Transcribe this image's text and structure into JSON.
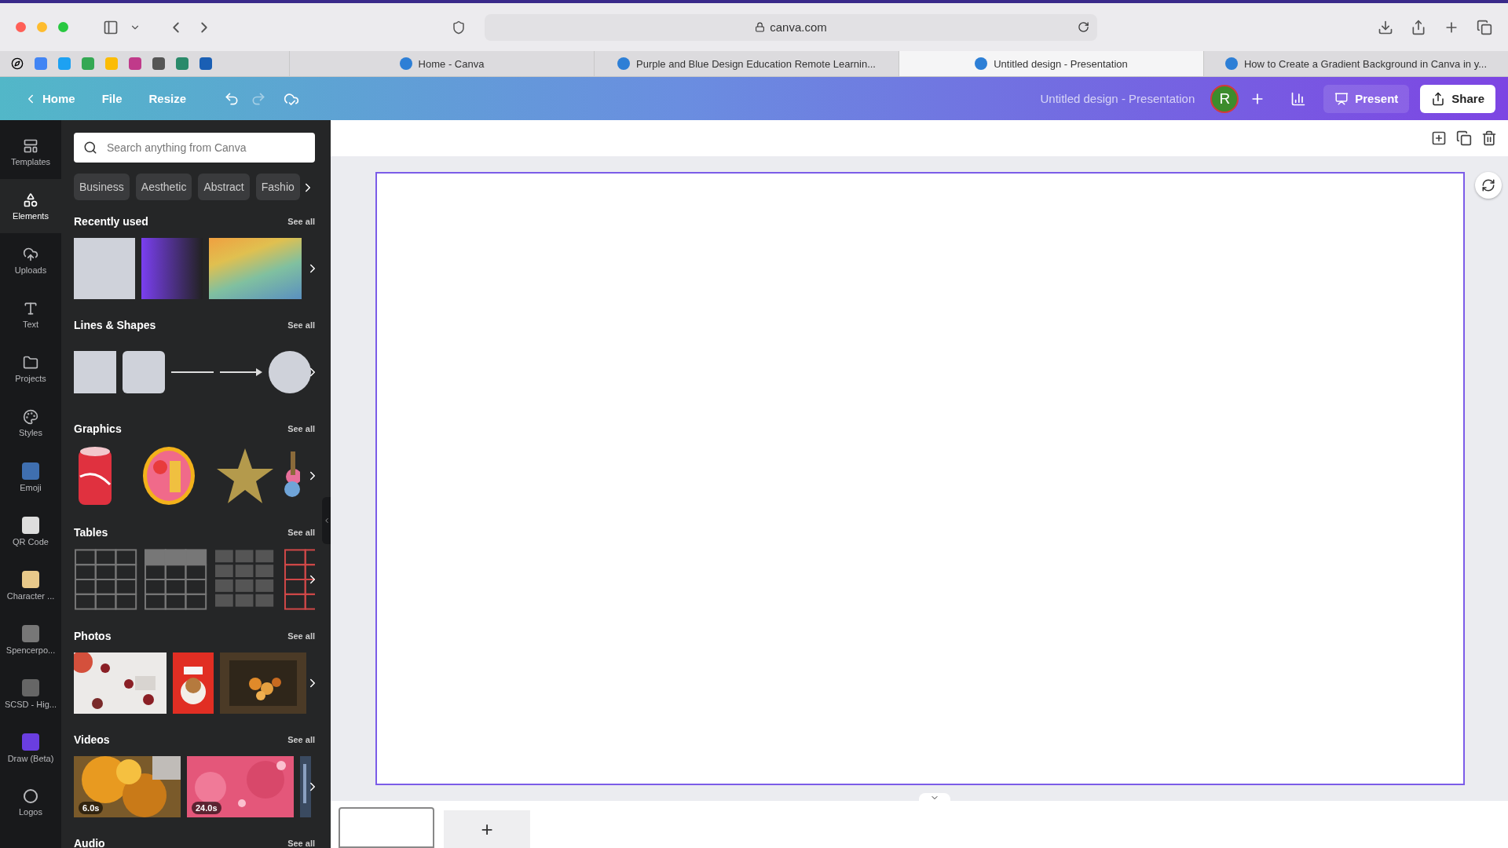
{
  "browser": {
    "url": "canva.com"
  },
  "tabs": [
    {
      "title": "Home - Canva",
      "selected": false
    },
    {
      "title": "Purple and Blue Design Education Remote Learnin...",
      "selected": false
    },
    {
      "title": "Untitled design - Presentation",
      "selected": true
    },
    {
      "title": "How to Create a Gradient Background in Canva in y...",
      "selected": false
    }
  ],
  "header": {
    "nav": [
      "Home",
      "File",
      "Resize"
    ],
    "redo_disabled": true,
    "design_title": "Untitled design - Presentation",
    "avatar": "R",
    "present": "Present",
    "share": "Share"
  },
  "rail": [
    {
      "label": "Templates",
      "selected": false
    },
    {
      "label": "Elements",
      "selected": true
    },
    {
      "label": "Uploads",
      "selected": false
    },
    {
      "label": "Text",
      "selected": false
    },
    {
      "label": "Projects",
      "selected": false
    },
    {
      "label": "Styles",
      "selected": false
    },
    {
      "label": "Emoji",
      "selected": false
    },
    {
      "label": "QR Code",
      "selected": false
    },
    {
      "label": "Character ...",
      "selected": false
    },
    {
      "label": "Spencerpo...",
      "selected": false
    },
    {
      "label": "SCSD - Hig...",
      "selected": false
    },
    {
      "label": "Draw (Beta)",
      "selected": false
    },
    {
      "label": "Logos",
      "selected": false
    }
  ],
  "panel": {
    "search": {
      "placeholder": "Search anything from Canva"
    },
    "chips": [
      "Business",
      "Aesthetic",
      "Abstract",
      "Fashio"
    ],
    "sections": [
      {
        "title": "Recently used",
        "see_all": "See all",
        "kind": "recent"
      },
      {
        "title": "Lines & Shapes",
        "see_all": "See all",
        "kind": "shapes"
      },
      {
        "title": "Graphics",
        "see_all": "See all",
        "kind": "graphics"
      },
      {
        "title": "Tables",
        "see_all": "See all",
        "kind": "tables"
      },
      {
        "title": "Photos",
        "see_all": "See all",
        "kind": "photos"
      },
      {
        "title": "Videos",
        "see_all": "See all",
        "kind": "videos",
        "durations": [
          "6.0s",
          "24.0s"
        ]
      },
      {
        "title": "Audio",
        "see_all": "See all",
        "kind": "audio"
      }
    ]
  },
  "pages": {
    "add": "+"
  }
}
